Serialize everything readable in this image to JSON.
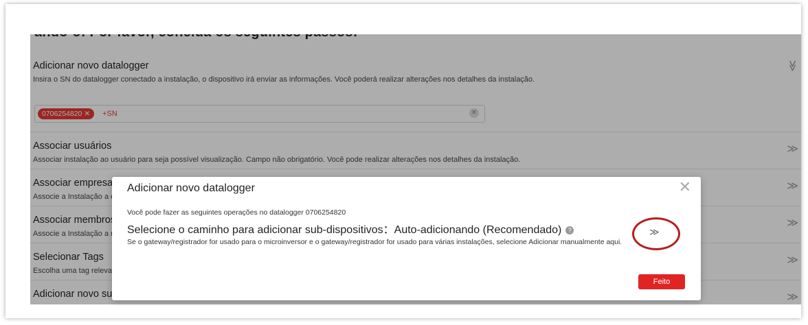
{
  "page": {
    "header_cut": "ando-o: Por favor, conclua os seguintes passos:",
    "steps": [
      {
        "title": "Adicionar novo datalogger",
        "desc": "Insira o SN do datalogger conectado a instalação, o dispositivo irá enviar as informações. Você poderá realizar alterações nos detalhes da instalação.",
        "chevron": "≫"
      },
      {
        "title": "Associar usuários",
        "desc": "Associar instalação ao usuário para seja possível visualização. Campo não obrigatório. Você pode realizar alterações nos detalhes da instalação.",
        "chevron": "≫"
      },
      {
        "title": "Associar empresas",
        "desc": "Associe a Instalação a empresas...",
        "chevron": "≫"
      },
      {
        "title": "Associar membros",
        "desc": "Associe a Instalação a membros...",
        "chevron": "≫"
      },
      {
        "title": "Selecionar Tags",
        "desc": "Escolha uma tag relevante...",
        "chevron": "≫"
      },
      {
        "title": "Adicionar novo sub",
        "desc": "",
        "chevron": "≫"
      }
    ],
    "sn_tag": "0706254820 ✕",
    "sn_add": "+SN",
    "sn_clear": "✕"
  },
  "modal": {
    "title": "Adicionar novo datalogger",
    "close": "✕",
    "info": "Você pode fazer as seguintes operações no datalogger 0706254820",
    "path_text": "Selecione o caminho para adicionar sub-dispositivos：Auto-adicionando (Recomendado)",
    "help": "?",
    "note": "Se o gateway/registrador for usado para o microinversor e o gateway/registrador for usado para várias instalações, selecione Adicionar manualmente aqui.",
    "expand": "≫",
    "done_label": "Feito"
  },
  "colors": {
    "accent": "#e02424",
    "highlight_ring": "#b71c1c"
  }
}
